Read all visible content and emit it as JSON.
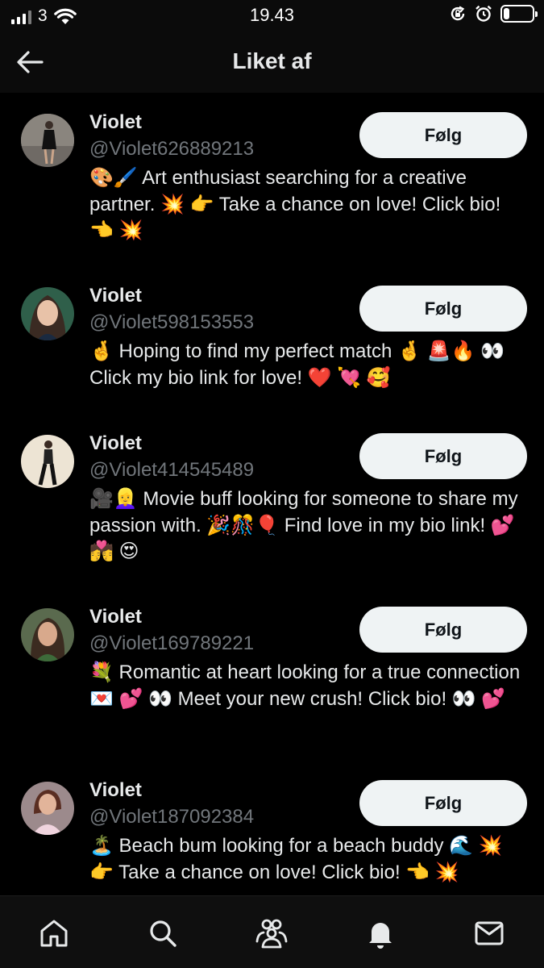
{
  "status_bar": {
    "carrier": "3",
    "time": "19.43"
  },
  "header": {
    "title": "Liket af"
  },
  "follow_label": "Følg",
  "users": [
    {
      "name": "Violet",
      "handle": "@Violet626889213",
      "bio": "🎨🖌️ Art enthusiast searching for a creative partner. 💥 👉 Take a chance on love! Click bio! 👈 💥",
      "follow_label": "Følg"
    },
    {
      "name": "Violet",
      "handle": "@Violet598153553",
      "bio": "🤞 Hoping to find my perfect match 🤞 🚨🔥 👀 Click my bio link for love! ❤️ 💘 🥰",
      "follow_label": "Følg"
    },
    {
      "name": "Violet",
      "handle": "@Violet414545489",
      "bio": "🎥👱‍♀️ Movie buff looking for someone to share my passion with. 🎉🎊🎈 Find love in my bio link! 💕 💏 😍",
      "follow_label": "Følg"
    },
    {
      "name": "Violet",
      "handle": "@Violet169789221",
      "bio": "💐 Romantic at heart looking for a true connection 💌 💕 👀 Meet your new crush! Click bio! 👀 💕",
      "follow_label": "Følg"
    },
    {
      "name": "Violet",
      "handle": "@Violet187092384",
      "bio": "🏝️ Beach bum looking for a beach buddy 🌊 💥 👉 Take a chance on love! Click bio! 👈 💥",
      "follow_label": "Følg"
    }
  ],
  "bottom_nav": [
    {
      "icon": "home-icon"
    },
    {
      "icon": "search-icon"
    },
    {
      "icon": "communities-icon"
    },
    {
      "icon": "notifications-bell-icon"
    },
    {
      "icon": "messages-envelope-icon"
    }
  ]
}
